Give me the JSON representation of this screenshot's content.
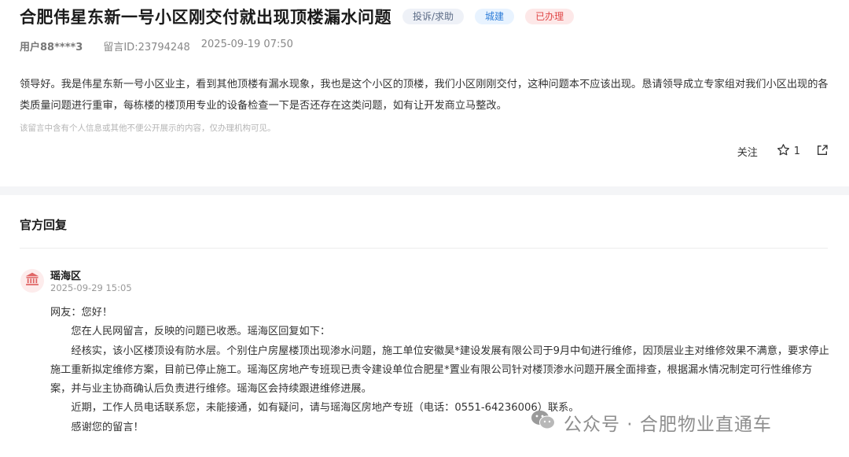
{
  "message": {
    "title": "合肥伟星东新一号小区刚交付就出现顶楼漏水问题",
    "tags": [
      "投诉/求助",
      "城建",
      "已办理"
    ],
    "user": "用户88****3",
    "id_text": "留言ID:23794248",
    "datetime": "2025-09-19 07:50",
    "content": "领导好。我是伟星东新一号小区业主，看到其他顶楼有漏水现象，我也是这个小区的顶楼，我们小区刚刚交付，这种问题本不应该出现。恳请领导成立专家组对我们小区出现的各类质量问题进行重审，每栋楼的楼顶用专业的设备检查一下是否还存在这类问题，如有让开发商立马整改。",
    "privacy_note": "该留言中含有个人信息或其他不便公开展示的内容，仅办理机构可见。",
    "actions": {
      "follow": "关注",
      "like_count": "1"
    }
  },
  "reply": {
    "heading": "官方回复",
    "department": "瑶海区",
    "datetime": "2025-09-29 15:05",
    "paragraphs": [
      "网友：您好！",
      "您在人民网留言，反映的问题已收悉。瑶海区回复如下：",
      "经核实，该小区楼顶设有防水层。个别住户房屋楼顶出现渗水问题，施工单位安徽昊*建设发展有限公司于9月中旬进行维修，因顶层业主对维修效果不满意，要求停止施工重新拟定维修方案，目前已停止施工。瑶海区房地产专班现已责令建设单位合肥星*置业有限公司针对楼顶渗水问题开展全面排查，根据漏水情况制定可行性维修方案，并与业主协商确认后负责进行维修。瑶海区会持续跟进维修进展。",
      "近期，工作人员电话联系您，未能接通，如有疑问，请与瑶海区房地产专班（电话：0551-64236006）联系。",
      "感谢您的留言！"
    ]
  },
  "watermark": "公众号 · 合肥物业直通车",
  "icons": {
    "like": "star-icon",
    "share": "share-icon",
    "avatar": "government-building-icon",
    "watermark": "wechat-icon"
  }
}
